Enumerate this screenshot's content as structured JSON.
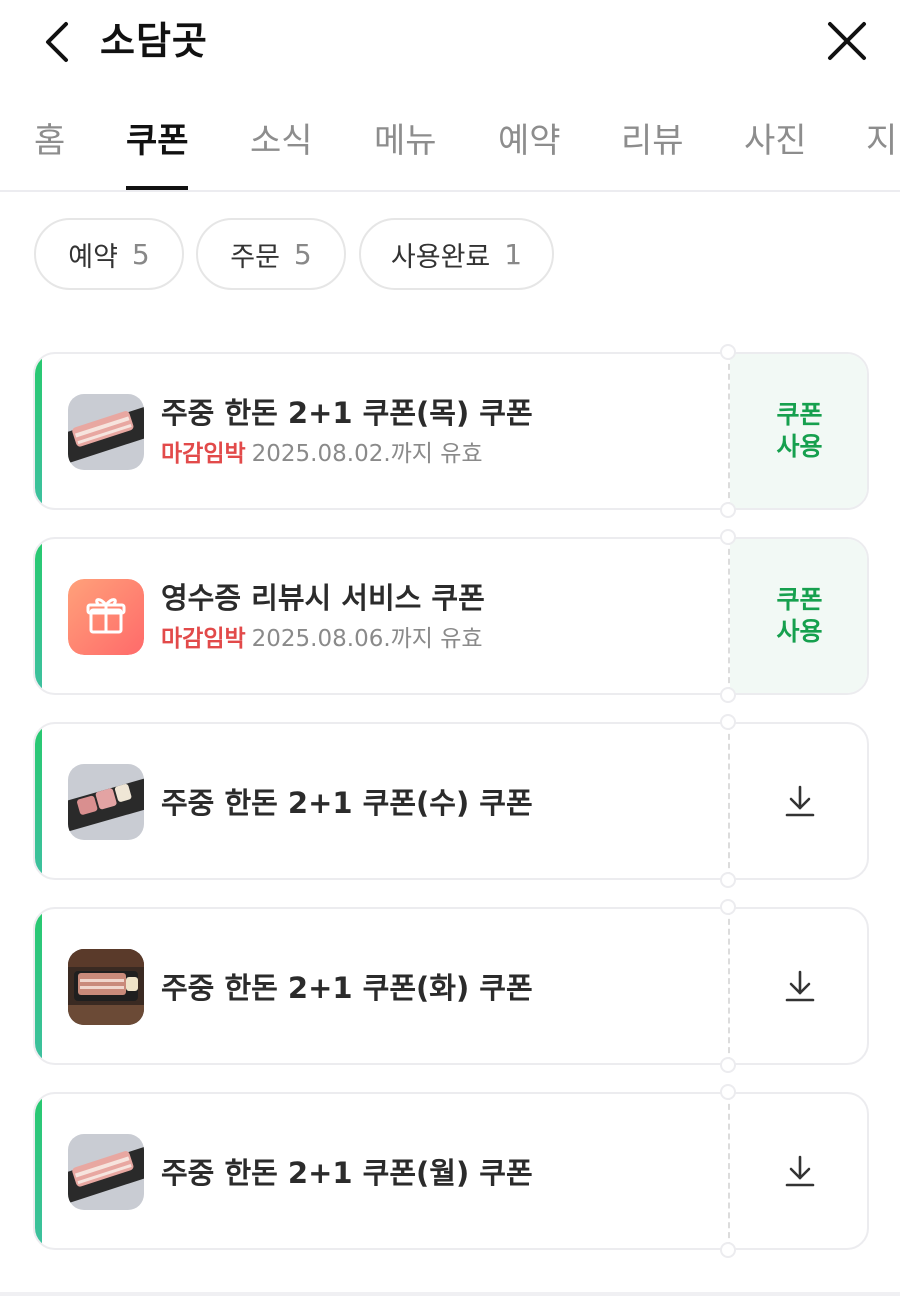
{
  "header": {
    "title": "소담곳"
  },
  "tabs": [
    {
      "label": "홈"
    },
    {
      "label": "쿠폰"
    },
    {
      "label": "소식"
    },
    {
      "label": "메뉴"
    },
    {
      "label": "예약"
    },
    {
      "label": "리뷰"
    },
    {
      "label": "사진"
    },
    {
      "label": "지"
    }
  ],
  "active_tab": "쿠폰",
  "filters": [
    {
      "label": "예약",
      "count": "5"
    },
    {
      "label": "주문",
      "count": "5"
    },
    {
      "label": "사용완료",
      "count": "1"
    }
  ],
  "coupons": [
    {
      "name": "주중 한돈 2+1 쿠폰(목) 쿠폰",
      "urgent": "마감임박",
      "expiry": "2025.08.02.까지 유효",
      "action": "use",
      "action_label": "쿠폰 사용",
      "thumb": "pork-belly-tray"
    },
    {
      "name": "영수증 리뷰시 서비스 쿠폰",
      "urgent": "마감임박",
      "expiry": "2025.08.06.까지 유효",
      "action": "use",
      "action_label": "쿠폰 사용",
      "thumb": "gift-icon"
    },
    {
      "name": "주중 한돈 2+1 쿠폰(수) 쿠폰",
      "action": "download",
      "thumb": "pork-cuts-tray"
    },
    {
      "name": "주중 한돈 2+1 쿠폰(화) 쿠폰",
      "action": "download",
      "thumb": "grilled-pork-grill"
    },
    {
      "name": "주중 한돈 2+1 쿠폰(월) 쿠폰",
      "action": "download",
      "thumb": "pork-belly-tray"
    }
  ],
  "colors": {
    "accent_green": "#16a04e",
    "urgent_red": "#e24a4a",
    "gift_gradient": "#ff7a6a"
  }
}
